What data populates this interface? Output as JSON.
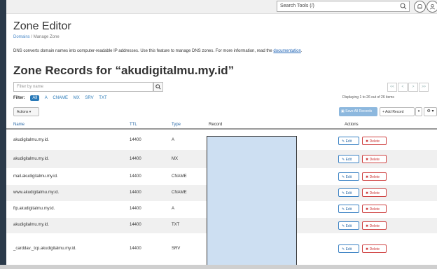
{
  "topbar": {
    "search_placeholder": "Search Tools (/)",
    "icons": [
      "search-icon",
      "bell-icon",
      "user-icon"
    ]
  },
  "page": {
    "title": "Zone Editor",
    "breadcrumb": {
      "link": "Domains",
      "sep": "/",
      "current": "Manage Zone"
    },
    "intro_text": "DNS converts domain names into computer-readable IP addresses. Use this feature to manage DNS zones. For more information, read the",
    "intro_link": "documentation",
    "intro_end": ".",
    "records_heading": "Zone Records for “akudigitalmu.my.id”"
  },
  "filter": {
    "placeholder": "Filter by name",
    "label": "Filter:",
    "chips": [
      "All",
      "A",
      "CNAME",
      "MX",
      "SRV",
      "TXT"
    ]
  },
  "pager": {
    "buttons": [
      "<<",
      "<",
      ">",
      ">>"
    ],
    "display": "Displaying 1 to 26 out of 26 items"
  },
  "toolbar": {
    "actions": "Actions ▾",
    "save_all": "Save All Records",
    "add_record": "+ Add Record",
    "caret": "▾",
    "gear": "⚙ ▾"
  },
  "table": {
    "headers": {
      "name": "Name",
      "ttl": "TTL",
      "type": "Type",
      "record": "Record",
      "actions": "Actions"
    },
    "edit_label": "✎ Edit",
    "delete_label": "✖ Delete",
    "rows": [
      {
        "name": "akudigitalmu.my.id.",
        "ttl": "14400",
        "type": "A"
      },
      {
        "name": "akudigitalmu.my.id.",
        "ttl": "14400",
        "type": "MX"
      },
      {
        "name": "mail.akudigitalmu.my.id.",
        "ttl": "14400",
        "type": "CNAME"
      },
      {
        "name": "www.akudigitalmu.my.id.",
        "ttl": "14400",
        "type": "CNAME"
      },
      {
        "name": "ftp.akudigitalmu.my.id.",
        "ttl": "14400",
        "type": "A"
      },
      {
        "name": "akudigitalmu.my.id.",
        "ttl": "14400",
        "type": "TXT"
      },
      {
        "name": "_carddav._tcp.akudigitalmu.my.id.",
        "ttl": "14400",
        "type": "SRV"
      }
    ]
  },
  "colors": {
    "accent": "#2a7ab8",
    "danger": "#d04545",
    "redaction": "#cddff2"
  }
}
